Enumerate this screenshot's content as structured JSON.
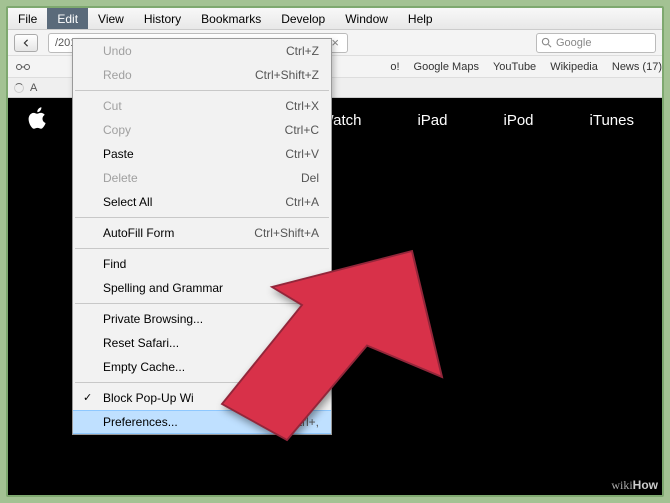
{
  "menubar": [
    "File",
    "Edit",
    "View",
    "History",
    "Bookmarks",
    "Develop",
    "Window",
    "Help"
  ],
  "openMenuIndex": 1,
  "url": "/2014-sept-event/",
  "search_placeholder": "Google",
  "bookmarks": [
    "o!",
    "Google Maps",
    "YouTube",
    "Wikipedia",
    "News (17)"
  ],
  "tab_label": "A",
  "apple_nav": [
    "Watch",
    "iPad",
    "iPod",
    "iTunes"
  ],
  "edit_menu": {
    "groups": [
      [
        {
          "label": "Undo",
          "shortcut": "Ctrl+Z",
          "disabled": true
        },
        {
          "label": "Redo",
          "shortcut": "Ctrl+Shift+Z",
          "disabled": true
        }
      ],
      [
        {
          "label": "Cut",
          "shortcut": "Ctrl+X",
          "disabled": true
        },
        {
          "label": "Copy",
          "shortcut": "Ctrl+C",
          "disabled": true
        },
        {
          "label": "Paste",
          "shortcut": "Ctrl+V"
        },
        {
          "label": "Delete",
          "shortcut": "Del",
          "disabled": true
        },
        {
          "label": "Select All",
          "shortcut": "Ctrl+A"
        }
      ],
      [
        {
          "label": "AutoFill Form",
          "shortcut": "Ctrl+Shift+A"
        }
      ],
      [
        {
          "label": "Find"
        },
        {
          "label": "Spelling and Grammar"
        }
      ],
      [
        {
          "label": "Private Browsing..."
        },
        {
          "label": "Reset Safari..."
        },
        {
          "label": "Empty Cache..."
        }
      ],
      [
        {
          "label": "Block Pop-Up Wi",
          "checked": true
        },
        {
          "label": "Preferences...",
          "shortcut": "Ctrl+,",
          "highlight": true
        }
      ]
    ]
  },
  "watermark": "wikiHow"
}
